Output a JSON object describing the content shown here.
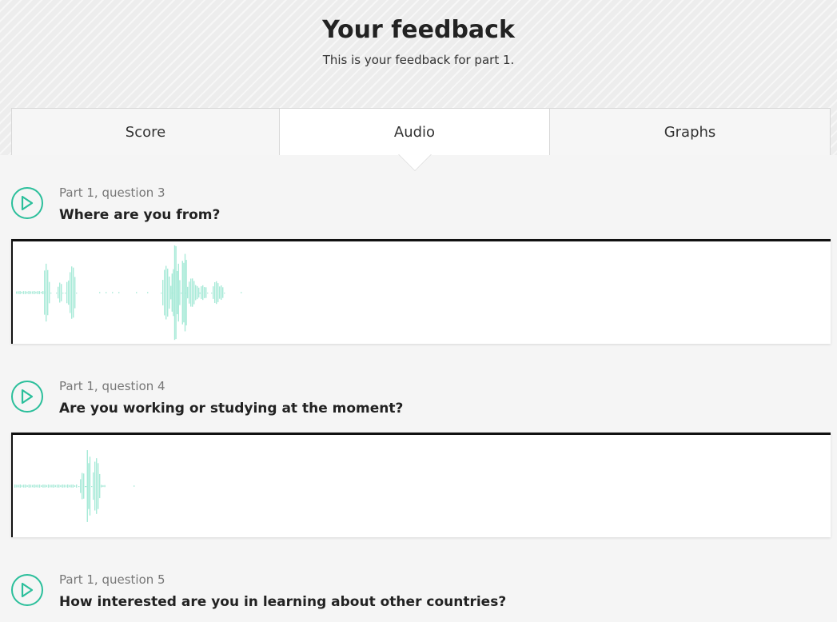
{
  "header": {
    "title": "Your feedback",
    "subtitle": "This is your feedback for part 1."
  },
  "tabs": [
    {
      "label": "Score",
      "active": false
    },
    {
      "label": "Audio",
      "active": true
    },
    {
      "label": "Graphs",
      "active": false
    }
  ],
  "questions": [
    {
      "meta": "Part 1, question 3",
      "text": "Where are you from?"
    },
    {
      "meta": "Part 1, question 4",
      "text": "Are you working or studying at the moment?"
    },
    {
      "meta": "Part 1, question 5",
      "text": "How interested are you in learning about other countries?"
    }
  ],
  "colors": {
    "accent": "#2bbf9b",
    "waveform": "#a8ead8"
  },
  "icons": {
    "play": "play-circle-icon"
  }
}
